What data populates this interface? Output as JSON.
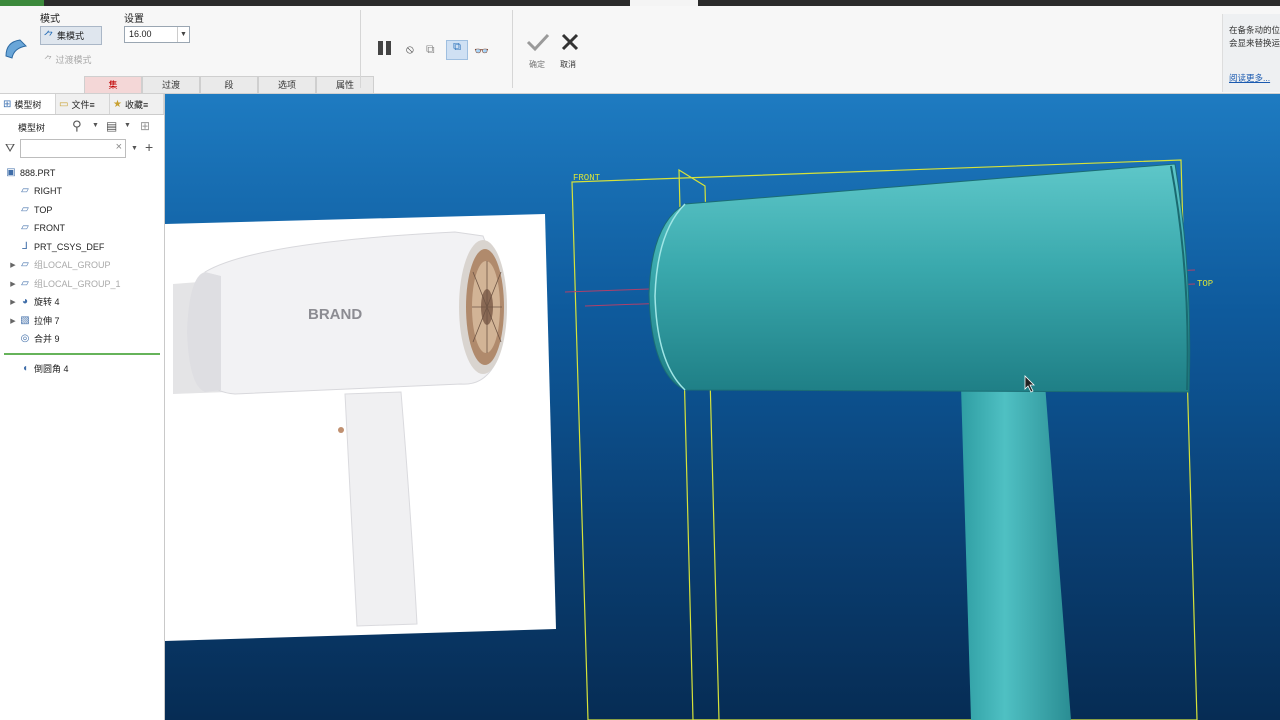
{
  "ribbon": {
    "mode_label": "模式",
    "mode_button": "集模式",
    "transition_mode": "过渡模式",
    "settings_label": "设置",
    "radius_value": "16.00",
    "subtabs": [
      {
        "label": "集",
        "active": true
      },
      {
        "label": "过渡",
        "active": false
      },
      {
        "label": "段",
        "active": false
      },
      {
        "label": "选项",
        "active": false
      },
      {
        "label": "属性",
        "active": false
      }
    ],
    "ok_label": "确定",
    "cancel_label": "取消",
    "help_line1": "在备条动的位",
    "help_line2": "会显来替换运",
    "help_link": "阅读更多..."
  },
  "panel": {
    "tabs": [
      {
        "label": "模型树",
        "icon": "model-tree-icon"
      },
      {
        "label": "文件≡",
        "icon": "folder-icon"
      },
      {
        "label": "收藏≡",
        "icon": "favorites-icon"
      }
    ],
    "header_label": "模型树",
    "tree": [
      {
        "label": "888.PRT",
        "icon": "part-icon",
        "grey": false,
        "expander": false,
        "indent": 0
      },
      {
        "label": "RIGHT",
        "icon": "datum-plane-icon",
        "grey": false,
        "expander": false,
        "indent": 1
      },
      {
        "label": "TOP",
        "icon": "datum-plane-icon",
        "grey": false,
        "expander": false,
        "indent": 1
      },
      {
        "label": "FRONT",
        "icon": "datum-plane-icon",
        "grey": false,
        "expander": false,
        "indent": 1
      },
      {
        "label": "PRT_CSYS_DEF",
        "icon": "csys-icon",
        "grey": false,
        "expander": false,
        "indent": 1
      },
      {
        "label": "组LOCAL_GROUP",
        "icon": "group-icon",
        "grey": true,
        "expander": true,
        "indent": 1
      },
      {
        "label": "组LOCAL_GROUP_1",
        "icon": "group-icon",
        "grey": true,
        "expander": true,
        "indent": 1
      },
      {
        "label": "旋转 4",
        "icon": "revolve-icon",
        "grey": false,
        "expander": true,
        "indent": 1
      },
      {
        "label": "拉伸 7",
        "icon": "extrude-icon",
        "grey": false,
        "expander": true,
        "indent": 1
      },
      {
        "label": "合并 9",
        "icon": "merge-icon",
        "grey": false,
        "expander": false,
        "indent": 1
      },
      {
        "label": "倒圆角 4",
        "icon": "round-icon",
        "grey": false,
        "expander": false,
        "indent": 1
      }
    ]
  },
  "viewport": {
    "front_label": "FRONT",
    "top_label": "TOP",
    "brand_text": "BRAND"
  }
}
